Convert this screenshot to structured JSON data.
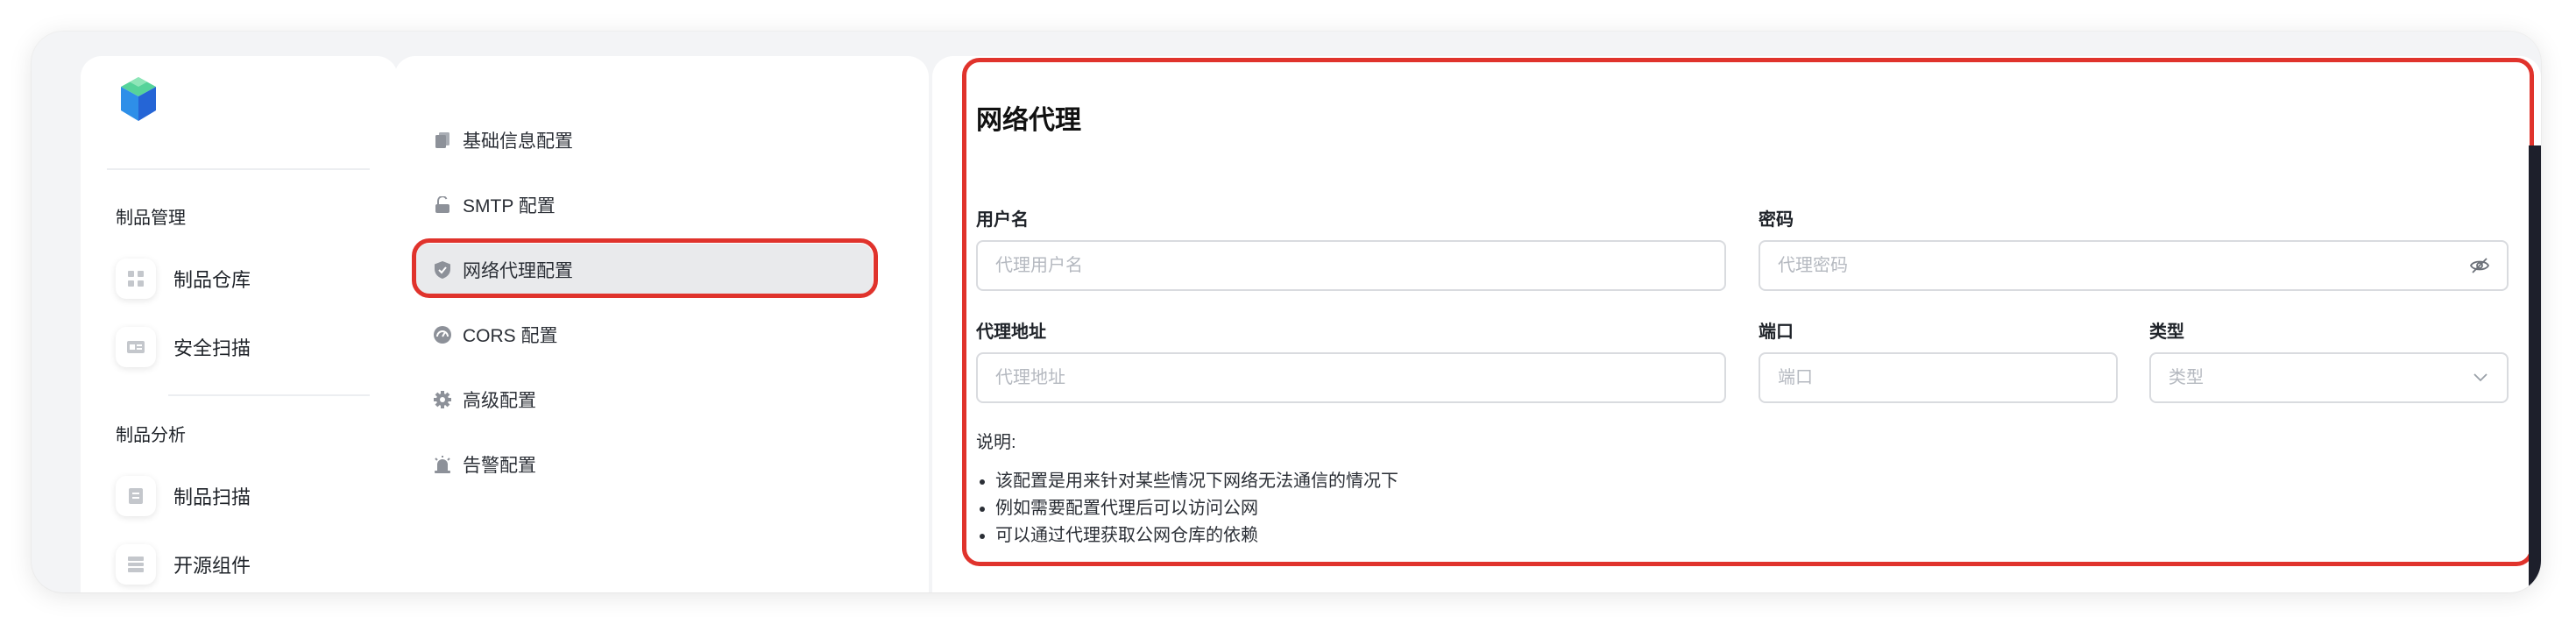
{
  "sidebar": {
    "groups": [
      {
        "title": "制品管理",
        "items": [
          {
            "label": "制品仓库",
            "icon": "grid-icon"
          },
          {
            "label": "安全扫描",
            "icon": "scan-card-icon"
          }
        ]
      },
      {
        "title": "制品分析",
        "items": [
          {
            "label": "制品扫描",
            "icon": "document-icon"
          },
          {
            "label": "开源组件",
            "icon": "list-icon"
          }
        ]
      }
    ]
  },
  "menu": {
    "items": [
      {
        "label": "基础信息配置",
        "icon": "files-icon"
      },
      {
        "label": "SMTP 配置",
        "icon": "lock-open-icon"
      },
      {
        "label": "网络代理配置",
        "icon": "shield-icon",
        "active": true
      },
      {
        "label": "CORS 配置",
        "icon": "gauge-icon"
      },
      {
        "label": "高级配置",
        "icon": "gear-icon"
      },
      {
        "label": "告警配置",
        "icon": "alarm-icon"
      }
    ]
  },
  "proxy": {
    "title": "网络代理",
    "username": {
      "label": "用户名",
      "placeholder": "代理用户名",
      "value": ""
    },
    "password": {
      "label": "密码",
      "placeholder": "代理密码",
      "value": ""
    },
    "address": {
      "label": "代理地址",
      "placeholder": "代理地址",
      "value": ""
    },
    "port": {
      "label": "端口",
      "placeholder": "端口",
      "value": ""
    },
    "type": {
      "label": "类型",
      "placeholder": "类型",
      "value": ""
    },
    "note_title": "说明:",
    "notes": [
      "该配置是用来针对某些情况下网络无法通信的情况下",
      "例如需要配置代理后可以访问公网",
      "可以通过代理获取公网仓库的依赖"
    ]
  },
  "colors": {
    "annotation_red": "#e0332c",
    "active_menu_bg": "#e9eaec",
    "logo_green": "#3fc28a",
    "logo_blue": "#2f6fe0"
  }
}
